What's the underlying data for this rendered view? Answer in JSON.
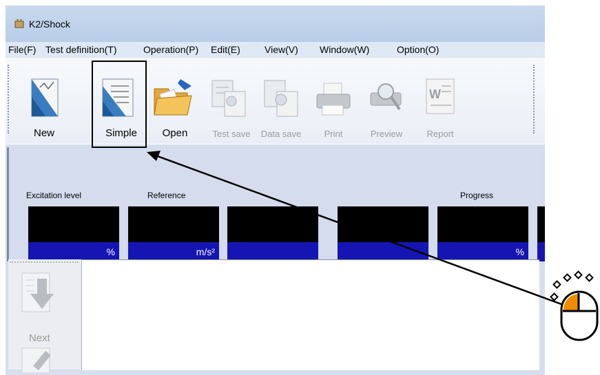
{
  "window": {
    "title": "K2/Shock"
  },
  "menu": [
    {
      "label": "File(F)"
    },
    {
      "label": "Test definition(T)"
    },
    {
      "label": "Operation(P)"
    },
    {
      "label": "Edit(E)"
    },
    {
      "label": "View(V)"
    },
    {
      "label": "Window(W)"
    },
    {
      "label": "Option(O)"
    }
  ],
  "toolbar": {
    "new": "New",
    "simple": "Simple",
    "open": "Open",
    "test_save": "Test save",
    "data_save": "Data save",
    "print": "Print",
    "preview": "Preview",
    "report": "Report"
  },
  "panel": {
    "excitation_label": "Excitation level",
    "reference_label": "Reference",
    "progress_label": "Progress",
    "meters": [
      {
        "unit": "%"
      },
      {
        "unit": "m/s²"
      },
      {
        "unit": ""
      },
      {
        "unit": ""
      },
      {
        "unit": "%"
      }
    ]
  },
  "sidebar": {
    "next": "Next"
  },
  "colors": {
    "meter_top": "#000000",
    "meter_bottom": "#1515b4",
    "mouse_button": "#f08c00"
  }
}
